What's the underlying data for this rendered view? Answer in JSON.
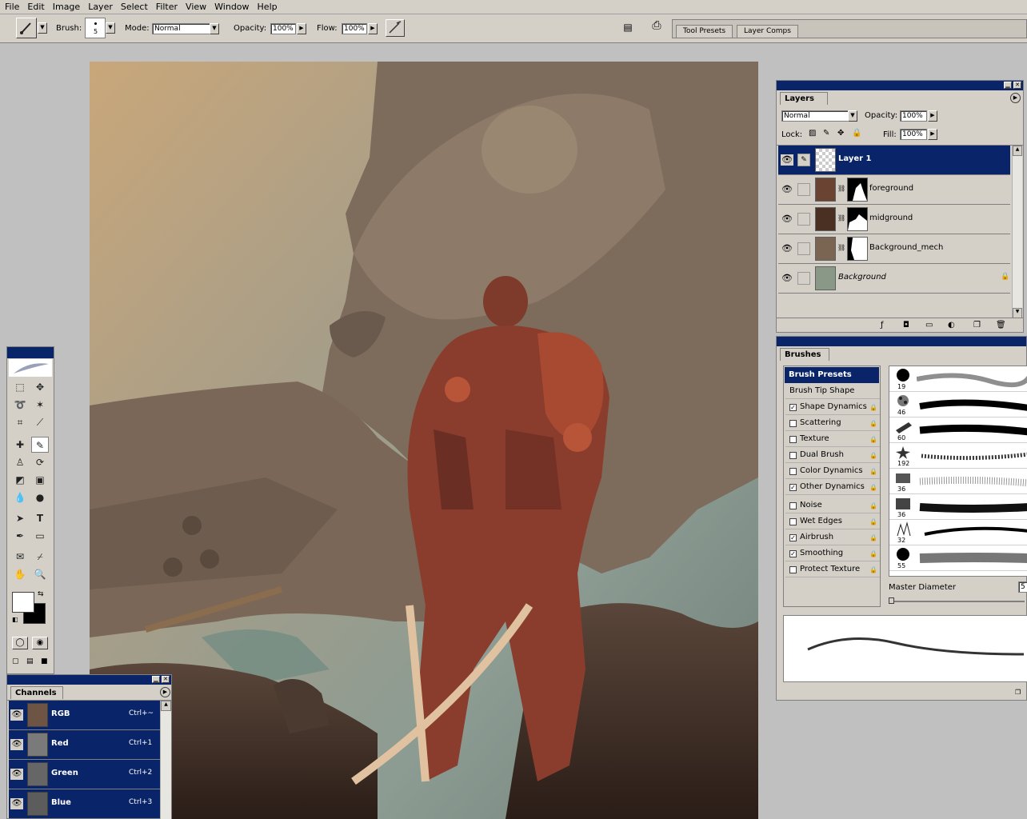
{
  "menu": [
    "File",
    "Edit",
    "Image",
    "Layer",
    "Select",
    "Filter",
    "View",
    "Window",
    "Help"
  ],
  "options_bar": {
    "brush_label": "Brush:",
    "brush_size": "5",
    "mode_label": "Mode:",
    "mode_value": "Normal",
    "opacity_label": "Opacity:",
    "opacity_value": "100%",
    "flow_label": "Flow:",
    "flow_value": "100%"
  },
  "palette_well": {
    "tabs": [
      "Tool Presets",
      "Layer Comps"
    ]
  },
  "layers_panel": {
    "tab": "Layers",
    "blend_mode": "Normal",
    "opacity_label": "Opacity:",
    "opacity_value": "100%",
    "lock_label": "Lock:",
    "fill_label": "Fill:",
    "fill_value": "100%",
    "layers": [
      {
        "name": "Layer 1",
        "selected": true
      },
      {
        "name": "foreground",
        "selected": false
      },
      {
        "name": "midground",
        "selected": false
      },
      {
        "name": "Background_mech",
        "selected": false
      },
      {
        "name": "Background",
        "selected": false,
        "locked": true
      }
    ]
  },
  "brushes_panel": {
    "tab": "Brushes",
    "presets_label": "Brush Presets",
    "tip_shape_label": "Brush Tip Shape",
    "options": [
      {
        "label": "Shape Dynamics",
        "checked": true
      },
      {
        "label": "Scattering",
        "checked": false
      },
      {
        "label": "Texture",
        "checked": false
      },
      {
        "label": "Dual Brush",
        "checked": false
      },
      {
        "label": "Color Dynamics",
        "checked": false
      },
      {
        "label": "Other Dynamics",
        "checked": true
      },
      {
        "label": "Noise",
        "checked": false
      },
      {
        "label": "Wet Edges",
        "checked": false
      },
      {
        "label": "Airbrush",
        "checked": true
      },
      {
        "label": "Smoothing",
        "checked": true
      },
      {
        "label": "Protect Texture",
        "checked": false
      }
    ],
    "brush_sizes": [
      "19",
      "46",
      "60",
      "192",
      "36",
      "36",
      "32",
      "55"
    ],
    "master_diameter_label": "Master Diameter",
    "master_diameter_value": "5"
  },
  "channels_panel": {
    "tab": "Channels",
    "channels": [
      {
        "name": "RGB",
        "shortcut": "Ctrl+~"
      },
      {
        "name": "Red",
        "shortcut": "Ctrl+1"
      },
      {
        "name": "Green",
        "shortcut": "Ctrl+2"
      },
      {
        "name": "Blue",
        "shortcut": "Ctrl+3"
      }
    ]
  },
  "colors": {
    "selection": "#0a246a",
    "chrome": "#d4d0c8"
  }
}
